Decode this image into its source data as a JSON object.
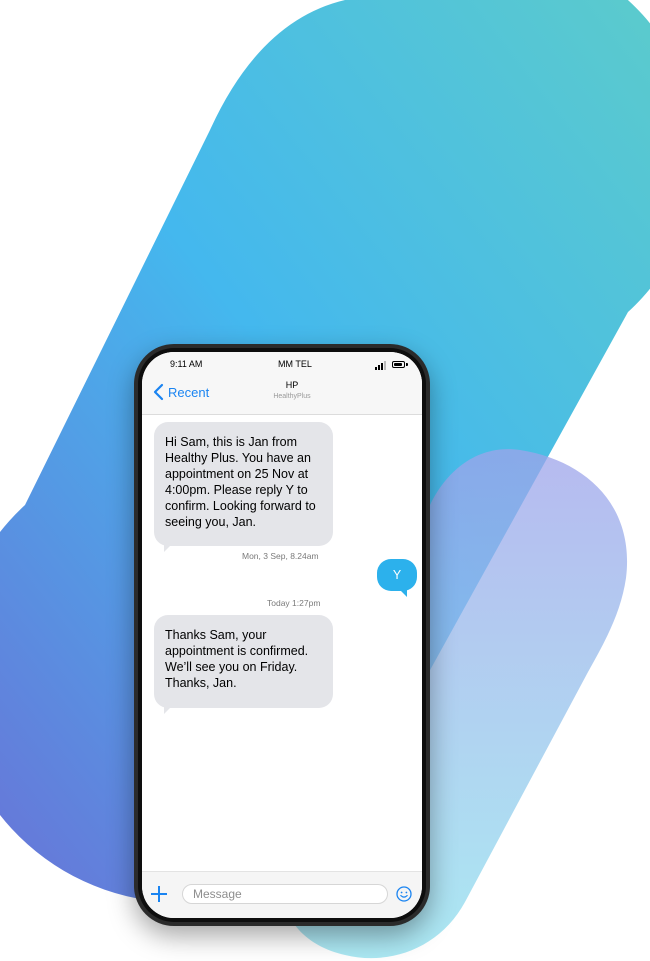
{
  "status_bar": {
    "time": "9:11 AM",
    "carrier": "MM TEL"
  },
  "header": {
    "back_label": "Recent",
    "contact_name": "HP",
    "contact_subtitle": "HealthyPlus"
  },
  "messages": [
    {
      "text": "Hi Sam, this is Jan from Healthy Plus. You have an appointment on 25 Nov at 4:00pm. Please reply Y to confirm. Looking forward to seeing you, Jan.",
      "timestamp": "Mon, 3 Sep, 8.24am"
    },
    {
      "text": "Y"
    },
    {
      "text": "Thanks Sam, your appointment is confirmed. We’ll see you on Friday. Thanks, Jan.",
      "timestamp": "Today 1:27pm"
    }
  ],
  "input": {
    "placeholder": "Message"
  },
  "icons": {
    "back": "chevron-left-icon",
    "add": "plus-icon",
    "emoji": "emoji-icon",
    "signal": "signal-icon",
    "battery": "battery-icon"
  },
  "colors": {
    "accent": "#1a84f1",
    "outgoing_bubble": "#2cb1ec",
    "incoming_bubble": "#e4e5e9"
  }
}
